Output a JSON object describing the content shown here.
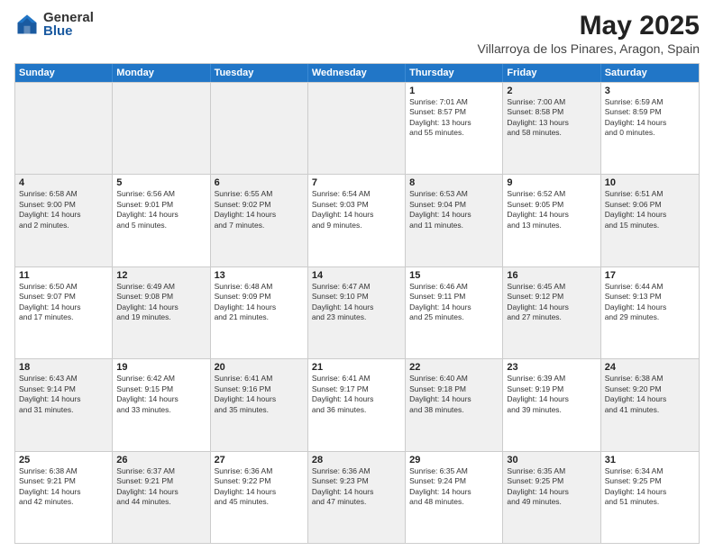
{
  "logo": {
    "general": "General",
    "blue": "Blue"
  },
  "title": "May 2025",
  "subtitle": "Villarroya de los Pinares, Aragon, Spain",
  "header_days": [
    "Sunday",
    "Monday",
    "Tuesday",
    "Wednesday",
    "Thursday",
    "Friday",
    "Saturday"
  ],
  "weeks": [
    [
      {
        "day": "",
        "shaded": true,
        "lines": []
      },
      {
        "day": "",
        "shaded": true,
        "lines": []
      },
      {
        "day": "",
        "shaded": true,
        "lines": []
      },
      {
        "day": "",
        "shaded": true,
        "lines": []
      },
      {
        "day": "1",
        "shaded": false,
        "lines": [
          "Sunrise: 7:01 AM",
          "Sunset: 8:57 PM",
          "Daylight: 13 hours",
          "and 55 minutes."
        ]
      },
      {
        "day": "2",
        "shaded": true,
        "lines": [
          "Sunrise: 7:00 AM",
          "Sunset: 8:58 PM",
          "Daylight: 13 hours",
          "and 58 minutes."
        ]
      },
      {
        "day": "3",
        "shaded": false,
        "lines": [
          "Sunrise: 6:59 AM",
          "Sunset: 8:59 PM",
          "Daylight: 14 hours",
          "and 0 minutes."
        ]
      }
    ],
    [
      {
        "day": "4",
        "shaded": true,
        "lines": [
          "Sunrise: 6:58 AM",
          "Sunset: 9:00 PM",
          "Daylight: 14 hours",
          "and 2 minutes."
        ]
      },
      {
        "day": "5",
        "shaded": false,
        "lines": [
          "Sunrise: 6:56 AM",
          "Sunset: 9:01 PM",
          "Daylight: 14 hours",
          "and 5 minutes."
        ]
      },
      {
        "day": "6",
        "shaded": true,
        "lines": [
          "Sunrise: 6:55 AM",
          "Sunset: 9:02 PM",
          "Daylight: 14 hours",
          "and 7 minutes."
        ]
      },
      {
        "day": "7",
        "shaded": false,
        "lines": [
          "Sunrise: 6:54 AM",
          "Sunset: 9:03 PM",
          "Daylight: 14 hours",
          "and 9 minutes."
        ]
      },
      {
        "day": "8",
        "shaded": true,
        "lines": [
          "Sunrise: 6:53 AM",
          "Sunset: 9:04 PM",
          "Daylight: 14 hours",
          "and 11 minutes."
        ]
      },
      {
        "day": "9",
        "shaded": false,
        "lines": [
          "Sunrise: 6:52 AM",
          "Sunset: 9:05 PM",
          "Daylight: 14 hours",
          "and 13 minutes."
        ]
      },
      {
        "day": "10",
        "shaded": true,
        "lines": [
          "Sunrise: 6:51 AM",
          "Sunset: 9:06 PM",
          "Daylight: 14 hours",
          "and 15 minutes."
        ]
      }
    ],
    [
      {
        "day": "11",
        "shaded": false,
        "lines": [
          "Sunrise: 6:50 AM",
          "Sunset: 9:07 PM",
          "Daylight: 14 hours",
          "and 17 minutes."
        ]
      },
      {
        "day": "12",
        "shaded": true,
        "lines": [
          "Sunrise: 6:49 AM",
          "Sunset: 9:08 PM",
          "Daylight: 14 hours",
          "and 19 minutes."
        ]
      },
      {
        "day": "13",
        "shaded": false,
        "lines": [
          "Sunrise: 6:48 AM",
          "Sunset: 9:09 PM",
          "Daylight: 14 hours",
          "and 21 minutes."
        ]
      },
      {
        "day": "14",
        "shaded": true,
        "lines": [
          "Sunrise: 6:47 AM",
          "Sunset: 9:10 PM",
          "Daylight: 14 hours",
          "and 23 minutes."
        ]
      },
      {
        "day": "15",
        "shaded": false,
        "lines": [
          "Sunrise: 6:46 AM",
          "Sunset: 9:11 PM",
          "Daylight: 14 hours",
          "and 25 minutes."
        ]
      },
      {
        "day": "16",
        "shaded": true,
        "lines": [
          "Sunrise: 6:45 AM",
          "Sunset: 9:12 PM",
          "Daylight: 14 hours",
          "and 27 minutes."
        ]
      },
      {
        "day": "17",
        "shaded": false,
        "lines": [
          "Sunrise: 6:44 AM",
          "Sunset: 9:13 PM",
          "Daylight: 14 hours",
          "and 29 minutes."
        ]
      }
    ],
    [
      {
        "day": "18",
        "shaded": true,
        "lines": [
          "Sunrise: 6:43 AM",
          "Sunset: 9:14 PM",
          "Daylight: 14 hours",
          "and 31 minutes."
        ]
      },
      {
        "day": "19",
        "shaded": false,
        "lines": [
          "Sunrise: 6:42 AM",
          "Sunset: 9:15 PM",
          "Daylight: 14 hours",
          "and 33 minutes."
        ]
      },
      {
        "day": "20",
        "shaded": true,
        "lines": [
          "Sunrise: 6:41 AM",
          "Sunset: 9:16 PM",
          "Daylight: 14 hours",
          "and 35 minutes."
        ]
      },
      {
        "day": "21",
        "shaded": false,
        "lines": [
          "Sunrise: 6:41 AM",
          "Sunset: 9:17 PM",
          "Daylight: 14 hours",
          "and 36 minutes."
        ]
      },
      {
        "day": "22",
        "shaded": true,
        "lines": [
          "Sunrise: 6:40 AM",
          "Sunset: 9:18 PM",
          "Daylight: 14 hours",
          "and 38 minutes."
        ]
      },
      {
        "day": "23",
        "shaded": false,
        "lines": [
          "Sunrise: 6:39 AM",
          "Sunset: 9:19 PM",
          "Daylight: 14 hours",
          "and 39 minutes."
        ]
      },
      {
        "day": "24",
        "shaded": true,
        "lines": [
          "Sunrise: 6:38 AM",
          "Sunset: 9:20 PM",
          "Daylight: 14 hours",
          "and 41 minutes."
        ]
      }
    ],
    [
      {
        "day": "25",
        "shaded": false,
        "lines": [
          "Sunrise: 6:38 AM",
          "Sunset: 9:21 PM",
          "Daylight: 14 hours",
          "and 42 minutes."
        ]
      },
      {
        "day": "26",
        "shaded": true,
        "lines": [
          "Sunrise: 6:37 AM",
          "Sunset: 9:21 PM",
          "Daylight: 14 hours",
          "and 44 minutes."
        ]
      },
      {
        "day": "27",
        "shaded": false,
        "lines": [
          "Sunrise: 6:36 AM",
          "Sunset: 9:22 PM",
          "Daylight: 14 hours",
          "and 45 minutes."
        ]
      },
      {
        "day": "28",
        "shaded": true,
        "lines": [
          "Sunrise: 6:36 AM",
          "Sunset: 9:23 PM",
          "Daylight: 14 hours",
          "and 47 minutes."
        ]
      },
      {
        "day": "29",
        "shaded": false,
        "lines": [
          "Sunrise: 6:35 AM",
          "Sunset: 9:24 PM",
          "Daylight: 14 hours",
          "and 48 minutes."
        ]
      },
      {
        "day": "30",
        "shaded": true,
        "lines": [
          "Sunrise: 6:35 AM",
          "Sunset: 9:25 PM",
          "Daylight: 14 hours",
          "and 49 minutes."
        ]
      },
      {
        "day": "31",
        "shaded": false,
        "lines": [
          "Sunrise: 6:34 AM",
          "Sunset: 9:25 PM",
          "Daylight: 14 hours",
          "and 51 minutes."
        ]
      }
    ]
  ]
}
